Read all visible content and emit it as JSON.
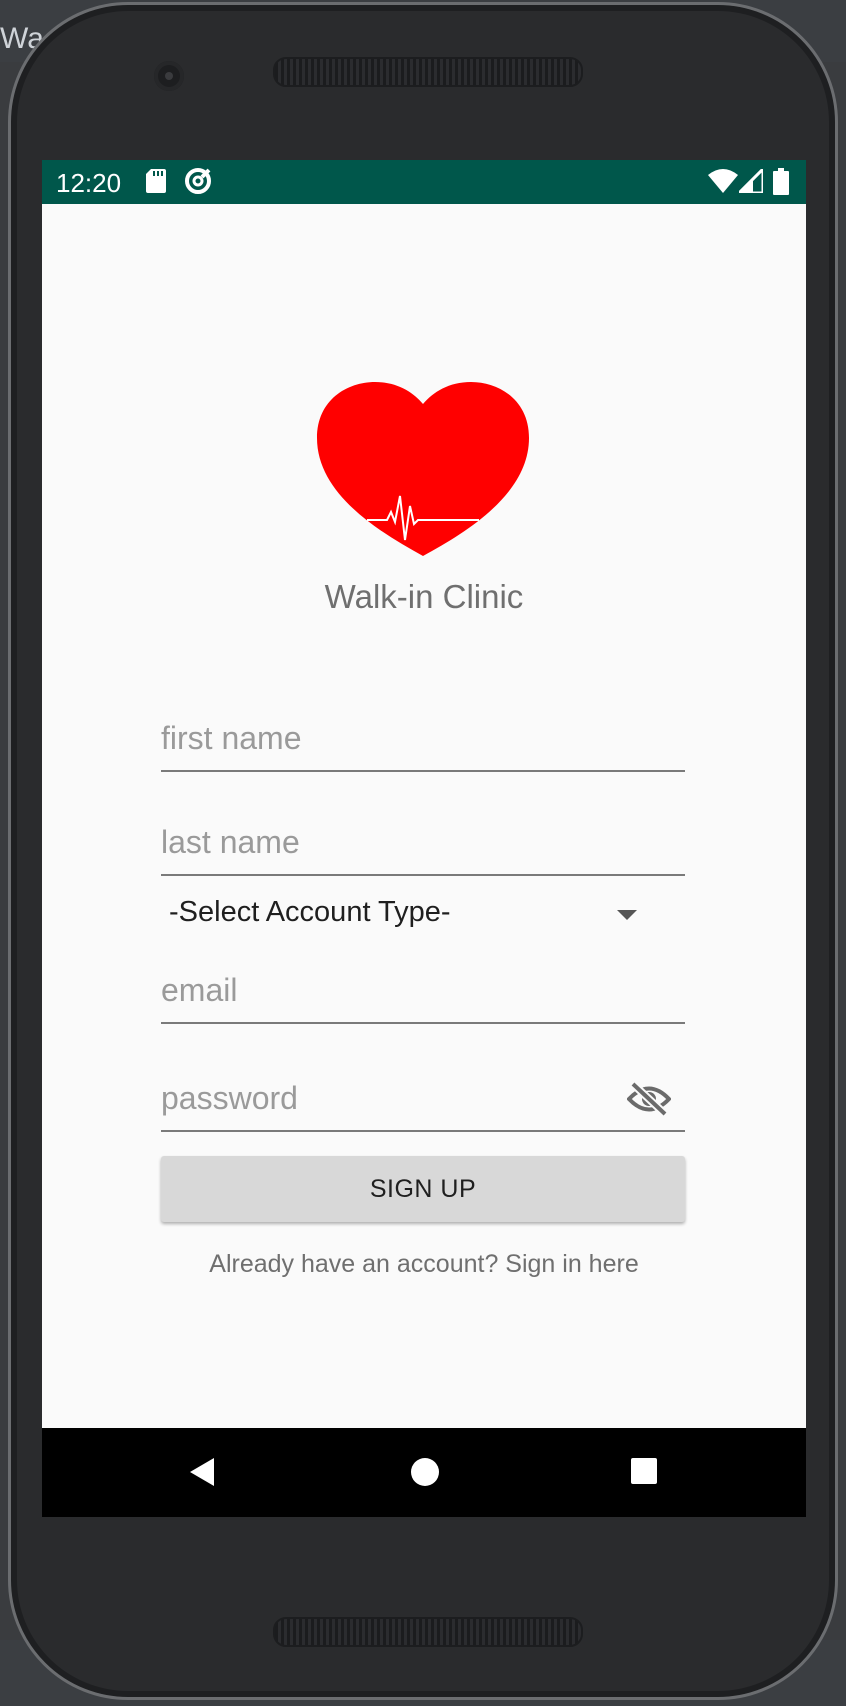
{
  "ide": {
    "title": "Wa"
  },
  "status_bar": {
    "time": "12:20",
    "icons": [
      "sd-card-icon",
      "data-saver-icon",
      "wifi-icon",
      "cell-signal-icon",
      "battery-icon"
    ],
    "color": "#00574b"
  },
  "app": {
    "name": "Walk-in Clinic",
    "logo": "heart-pulse-icon",
    "logo_color": "#ff0000"
  },
  "form": {
    "first_name_placeholder": "first name",
    "last_name_placeholder": "last name",
    "account_type": {
      "selected": "-Select Account Type-"
    },
    "email_placeholder": "email",
    "password_placeholder": "password",
    "password_toggle_icon": "visibility-off-icon"
  },
  "buttons": {
    "signup_label": "SIGN UP"
  },
  "links": {
    "signin": "Already have an account? Sign in here"
  },
  "nav_bar": {
    "buttons": [
      "back-icon",
      "home-icon",
      "recents-icon"
    ]
  }
}
